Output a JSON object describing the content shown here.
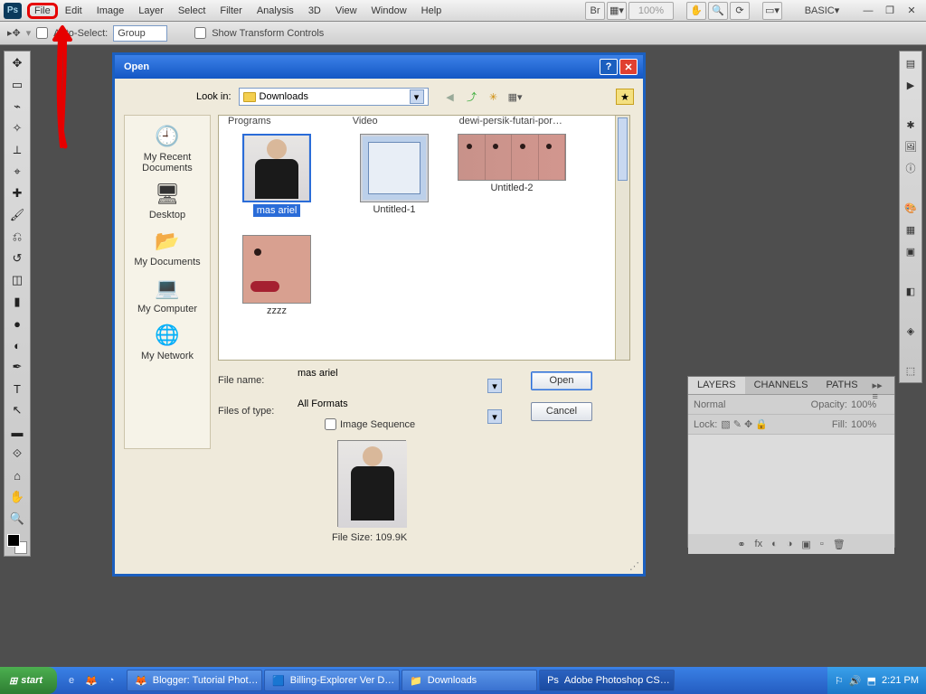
{
  "menu": {
    "items": [
      "File",
      "Edit",
      "Image",
      "Layer",
      "Select",
      "Filter",
      "Analysis",
      "3D",
      "View",
      "Window",
      "Help"
    ],
    "zoom": "100%",
    "workspace": "BASIC"
  },
  "opts": {
    "auto": "Auto-Select:",
    "group": "Group",
    "show": "Show Transform Controls"
  },
  "dialog": {
    "title": "Open",
    "lookin_label": "Look in:",
    "lookin_value": "Downloads",
    "headers": [
      "Programs",
      "Video",
      "dewi-persik-futari-por…"
    ],
    "places": [
      {
        "name": "My Recent Documents",
        "icon": "🕘"
      },
      {
        "name": "Desktop",
        "icon": "🖥"
      },
      {
        "name": "My Documents",
        "icon": "📂"
      },
      {
        "name": "My Computer",
        "icon": "💻"
      },
      {
        "name": "My Network",
        "icon": "🌐"
      }
    ],
    "files": [
      {
        "name": "mas ariel",
        "sel": true,
        "kind": "person"
      },
      {
        "name": "Untitled-1",
        "kind": "ss"
      },
      {
        "name": "Untitled-2",
        "kind": "faces"
      },
      {
        "name": "zzzz",
        "kind": "face"
      }
    ],
    "filename_label": "File name:",
    "filename_value": "mas ariel",
    "type_label": "Files of type:",
    "type_value": "All Formats",
    "open": "Open",
    "cancel": "Cancel",
    "sequence": "Image Sequence",
    "filesize": "File Size:  109.9K"
  },
  "layers": {
    "tabs": [
      "LAYERS",
      "CHANNELS",
      "PATHS"
    ],
    "mode": "Normal",
    "opacity_lbl": "Opacity:",
    "opacity": "100%",
    "lock": "Lock:",
    "fill_lbl": "Fill:",
    "fill": "100%"
  },
  "taskbar": {
    "start": "start",
    "tasks": [
      {
        "label": "Blogger: Tutorial Phot…",
        "active": false
      },
      {
        "label": "Billing-Explorer Ver D…",
        "active": false
      },
      {
        "label": "Downloads",
        "active": false
      },
      {
        "label": "Adobe Photoshop CS…",
        "active": true
      }
    ],
    "time": "2:21 PM"
  }
}
